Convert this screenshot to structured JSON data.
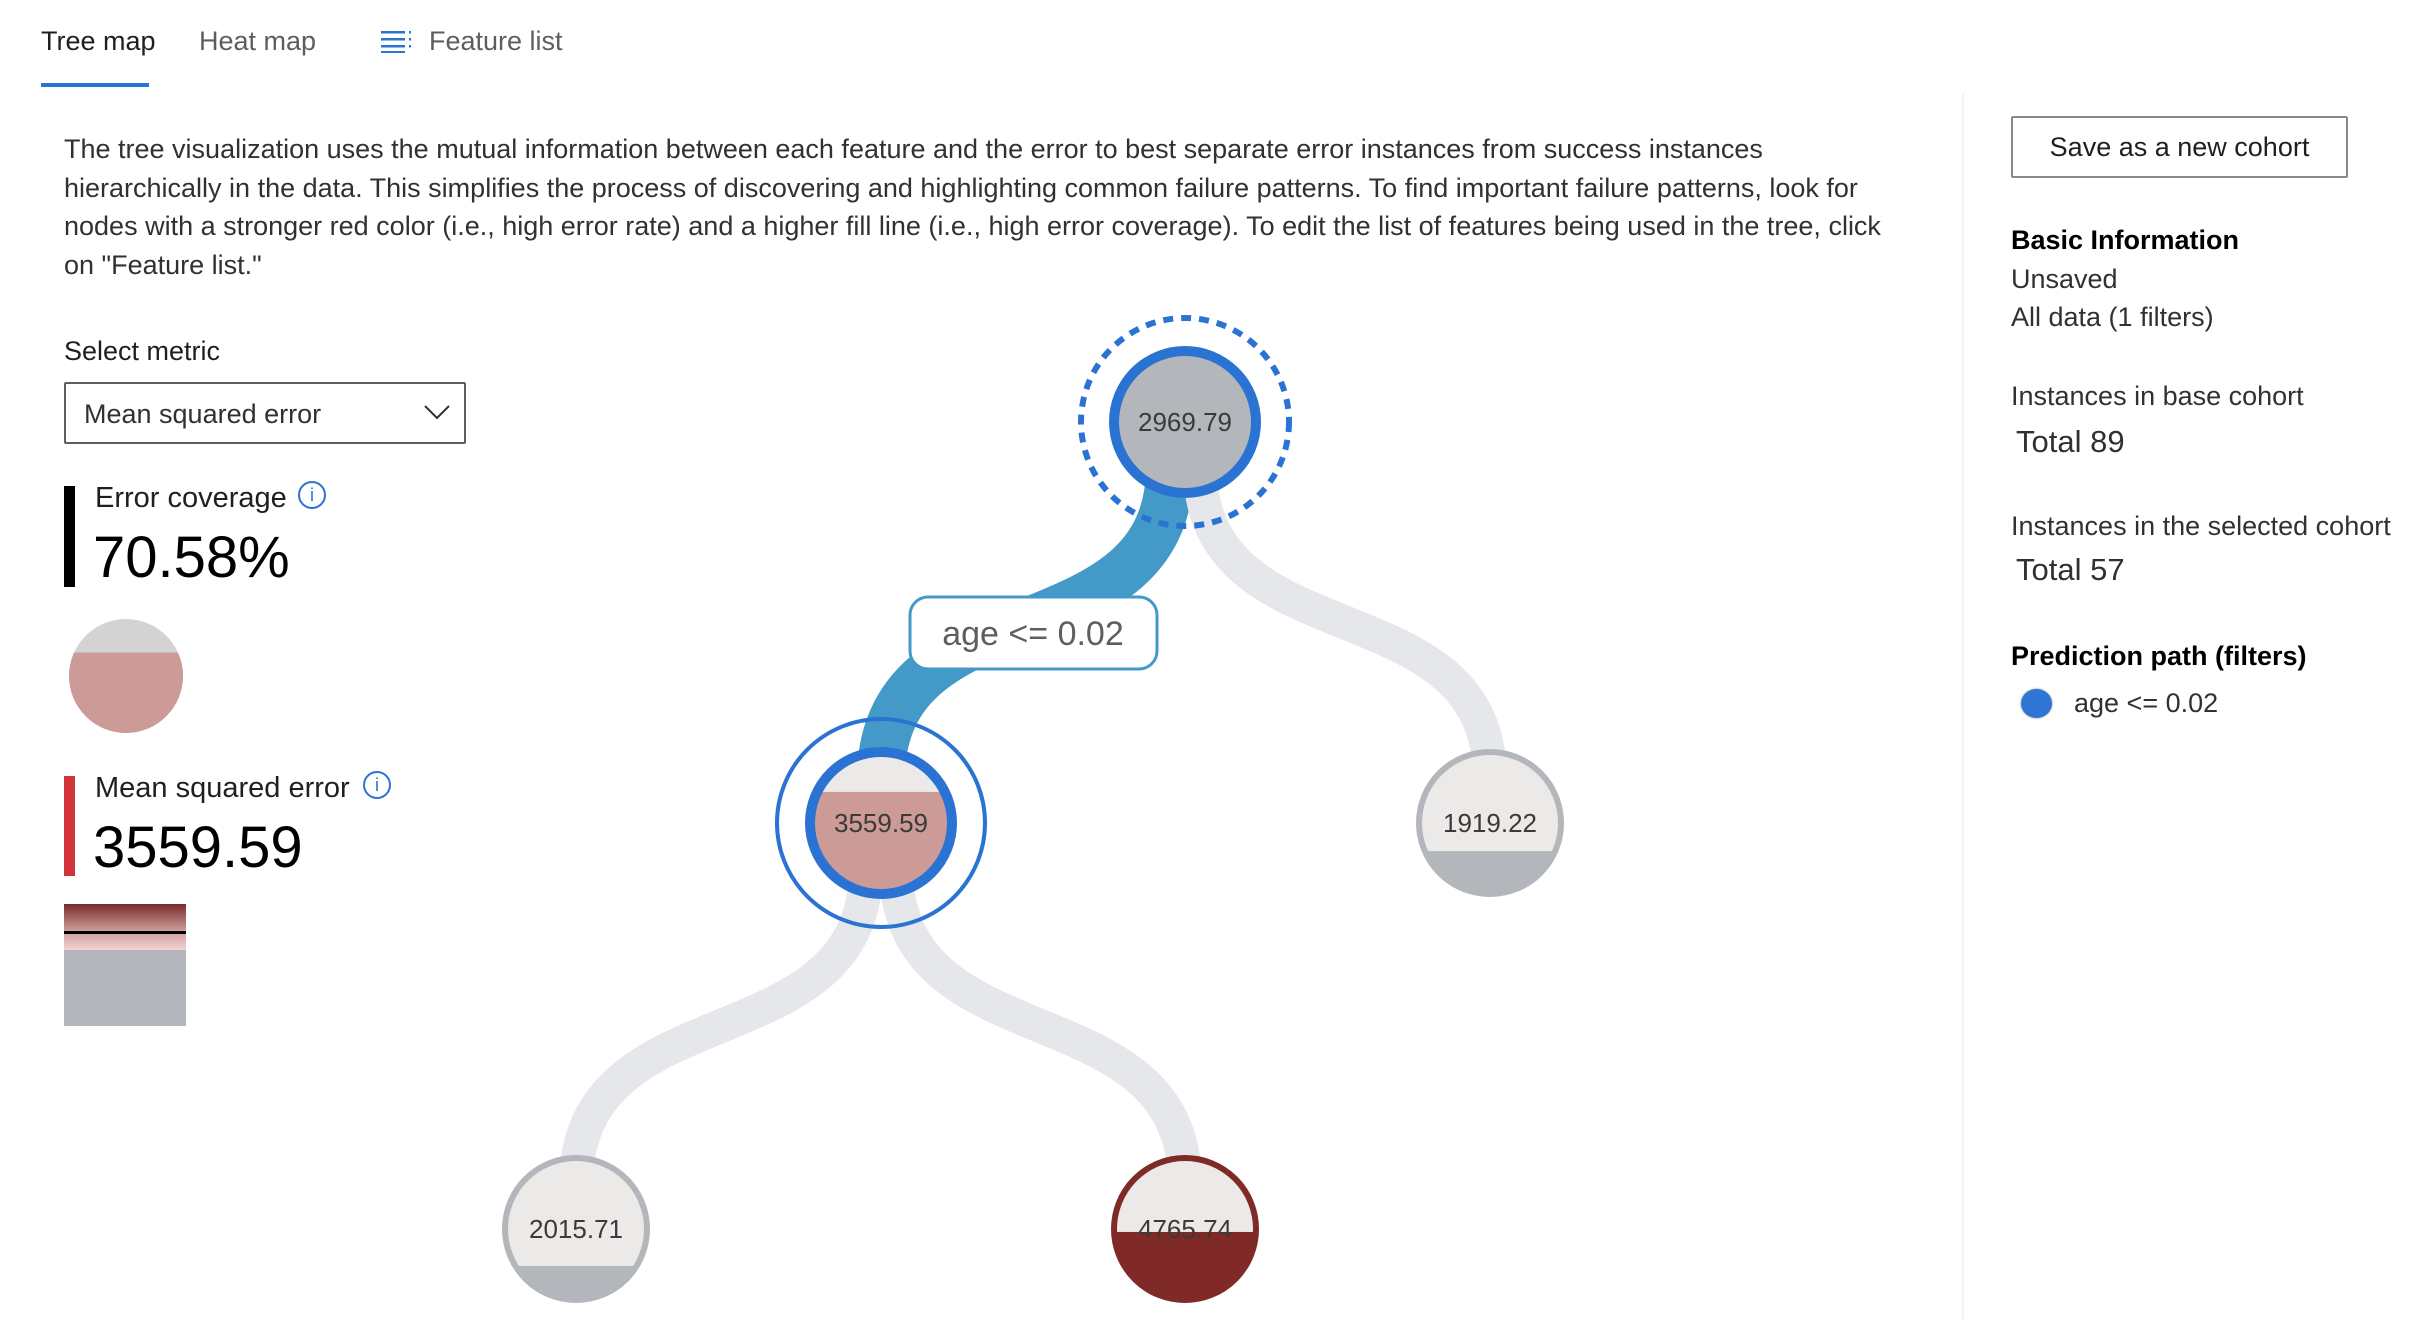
{
  "tabs": [
    {
      "label": "Tree map",
      "active": true
    },
    {
      "label": "Heat map",
      "active": false
    },
    {
      "label": "Feature list",
      "icon": "list-icon",
      "active": false
    }
  ],
  "description": "The tree visualization uses the mutual information between each feature and the error to best separate error instances from success instances hierarchically in the data. This simplifies the process of discovering and highlighting common failure patterns. To find important failure patterns, look for nodes with a stronger red color (i.e., high error rate) and a higher fill line (i.e., high error coverage). To edit the list of features being used in the tree, click on \"Feature list.\"",
  "metric": {
    "label": "Select metric",
    "selected": "Mean squared error",
    "error_coverage_label": "Error coverage",
    "error_coverage_value": "70.58%",
    "error_coverage_fraction": 0.7058,
    "metric_label": "Mean squared error",
    "metric_value": "3559.59"
  },
  "colors": {
    "accent": "#2b73d2",
    "link_selected": "#4399c8",
    "link": "#e6e7eb",
    "node_gray": "#b3b6bb",
    "node_bg": "#eceae8",
    "error_light": "#cc9a97",
    "error_dark": "#802a28"
  },
  "tree": {
    "nodes": [
      {
        "id": "root",
        "value": "2969.79",
        "fill": 1.0,
        "fill_color": "#b3b6bb",
        "border": "#2b73d2",
        "selected_path": true,
        "root": true
      },
      {
        "id": "left",
        "value": "3559.59",
        "fill": 0.71,
        "fill_color": "#cc9a97",
        "border": "#2b73d2",
        "selected": true,
        "parent": "root",
        "condition": "age <= 0.02"
      },
      {
        "id": "right",
        "value": "1919.22",
        "fill": 0.31,
        "fill_color": "#b3b6bb",
        "border": "#b3b6bb",
        "parent": "root"
      },
      {
        "id": "left-left",
        "value": "2015.71",
        "fill": 0.25,
        "fill_color": "#b3b6bb",
        "border": "#b3b6bb",
        "parent": "left"
      },
      {
        "id": "left-right",
        "value": "4765.74",
        "fill": 0.48,
        "fill_color": "#802a28",
        "border": "#802a28",
        "parent": "left"
      }
    ]
  },
  "right_panel": {
    "save_button": "Save as a new cohort",
    "basic_info_title": "Basic Information",
    "cohort_name": "Unsaved",
    "cohort_filters": "All data (1 filters)",
    "base_cohort_label": "Instances in base cohort",
    "base_cohort_total": "Total 89",
    "selected_cohort_label": "Instances in the selected cohort",
    "selected_cohort_total": "Total 57",
    "prediction_path_title": "Prediction path (filters)",
    "filters": [
      "age <= 0.02"
    ]
  }
}
